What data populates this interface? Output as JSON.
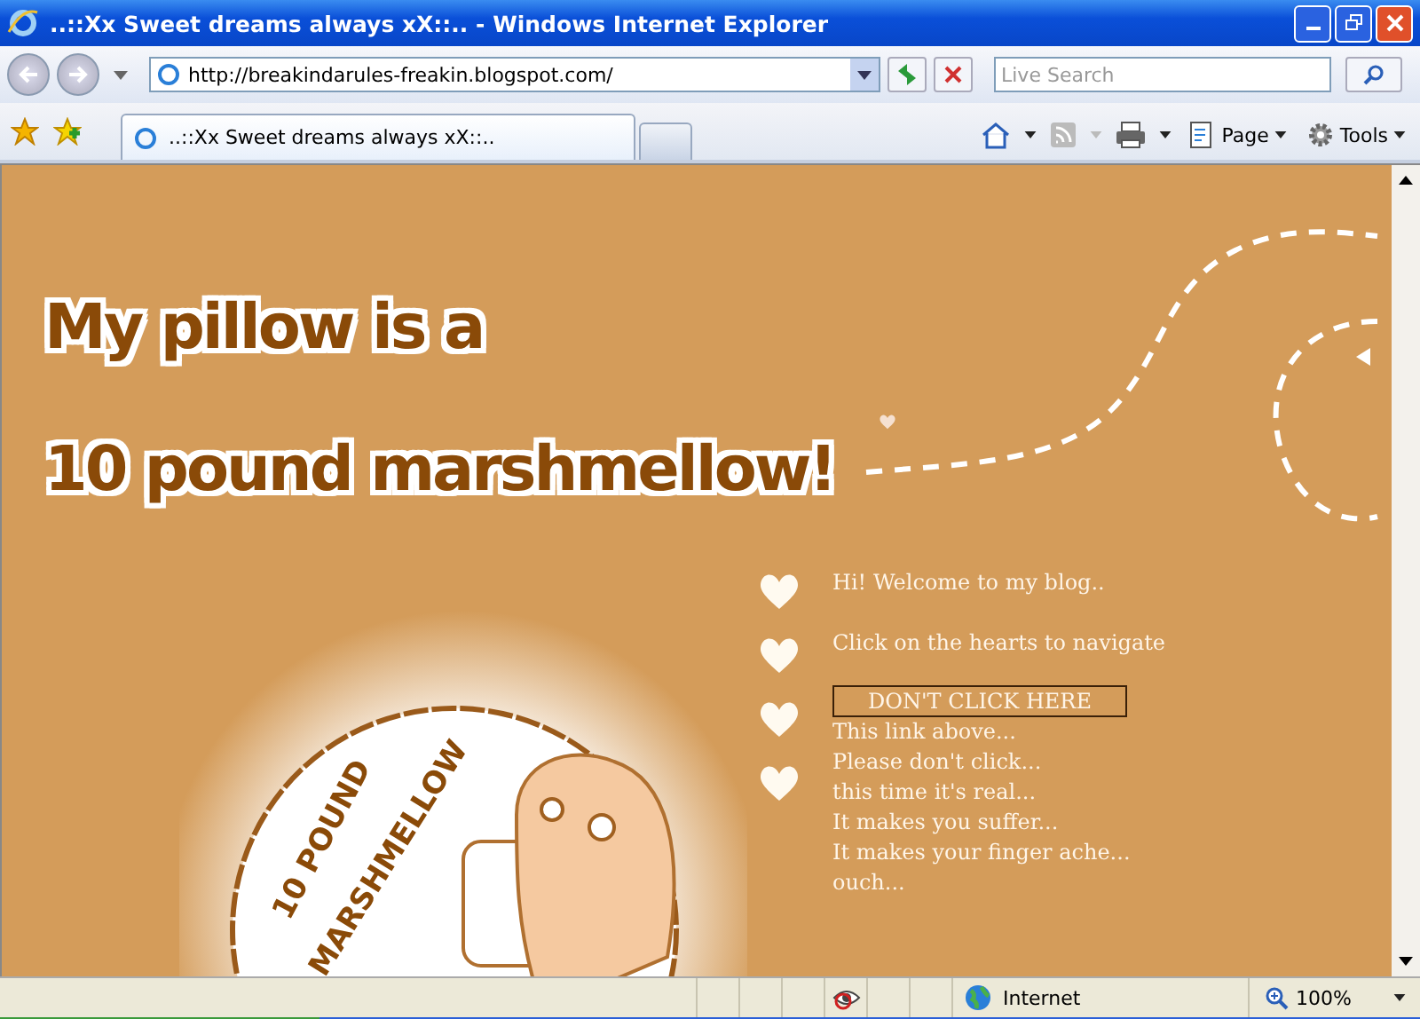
{
  "window": {
    "title": "..::Xx Sweet dreams always xX::.. - Windows Internet Explorer"
  },
  "address_bar": {
    "url": "http://breakindarules-freakin.blogspot.com/"
  },
  "search": {
    "placeholder": "Live Search"
  },
  "tabs": [
    {
      "label": "..::Xx Sweet dreams always xX::..",
      "selected": true
    }
  ],
  "command_bar": [
    "Page",
    "Tools"
  ],
  "page": {
    "title_lines": [
      "My pillow is a",
      "10 pound marshmellow!"
    ],
    "illustration_caption": [
      "10 POUND",
      "MARSHMELLOW"
    ],
    "nav": [
      {
        "kind": "text",
        "text": "Hi! Welcome to my blog.."
      },
      {
        "kind": "text",
        "text": "Click on the hearts to navigate"
      },
      {
        "kind": "link",
        "text": "DON'T CLICK HERE"
      }
    ],
    "paragraph_lines": [
      "This link above...",
      "Please don't click...",
      "this time it's real...",
      "It makes you suffer...",
      "It makes your finger ache...",
      "ouch..."
    ]
  },
  "status_bar": {
    "zone": "Internet",
    "zoom": "100%"
  }
}
